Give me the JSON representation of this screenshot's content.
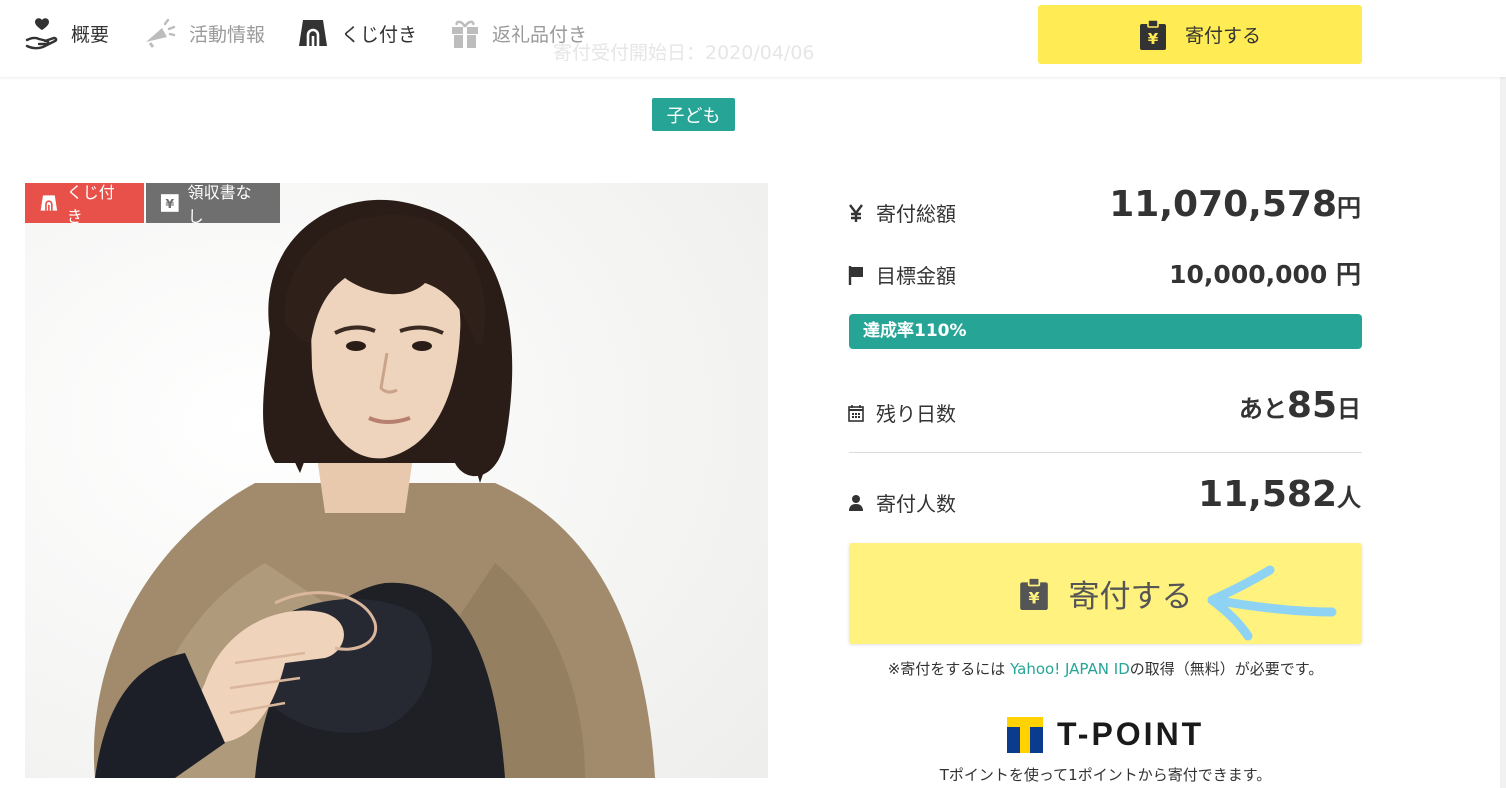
{
  "nav": {
    "items": [
      {
        "label": "概要",
        "icon": "hand-heart-icon"
      },
      {
        "label": "活動情報",
        "icon": "megaphone-icon"
      },
      {
        "label": "くじ付き",
        "icon": "lottery-icon"
      },
      {
        "label": "返礼品付き",
        "icon": "gift-icon"
      }
    ],
    "start_date_text": "寄付受付開始日：2020/04/06",
    "donate_label": "寄付する"
  },
  "category_tag": "子ども",
  "photo": {
    "badges": [
      {
        "label": "くじ付き",
        "icon": "lottery-icon",
        "color": "#e8514a"
      },
      {
        "label": "領収書なし",
        "icon": "receipt-yen-icon",
        "color": "#6f6f6f"
      }
    ]
  },
  "stats": {
    "total": {
      "label": "寄付総額",
      "icon": "yen-icon",
      "value": "11,070,578",
      "unit": "円"
    },
    "goal": {
      "label": "目標金額",
      "icon": "flag-icon",
      "value": "10,000,000 円"
    },
    "achievement": {
      "label": "達成率110%",
      "rate_percent": 110,
      "color": "#26a596"
    },
    "remaining": {
      "label": "残り日数",
      "icon": "calendar-icon",
      "prefix": "あと",
      "value": "85",
      "unit": "日"
    },
    "donors": {
      "label": "寄付人数",
      "icon": "person-icon",
      "value": "11,582",
      "unit": "人"
    }
  },
  "donate_button": {
    "label": "寄付する",
    "color": "#fff27e"
  },
  "note": {
    "prefix": "※寄付をするには ",
    "link": "Yahoo! JAPAN ID",
    "suffix": "の取得（無料）が必要です。"
  },
  "tpoint": {
    "logo_text": "T-POINT",
    "note": "Tポイントを使って1ポイントから寄付できます。"
  },
  "colors": {
    "accent": "#26a596",
    "button_yellow": "#ffec54",
    "lottery_red": "#e8514a"
  }
}
